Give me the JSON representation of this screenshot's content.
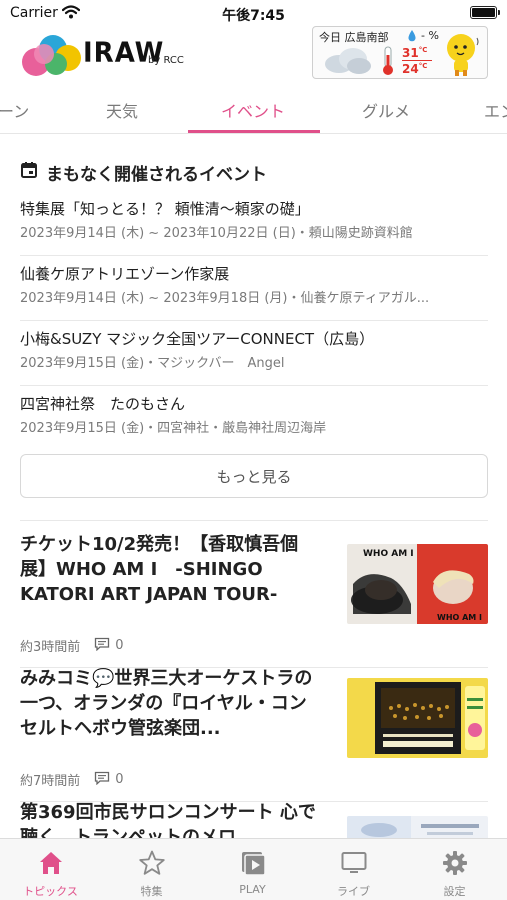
{
  "status_bar": {
    "carrier": "Carrier",
    "time": "午後7:45"
  },
  "header": {
    "logo_text": "IRAW",
    "logo_by": "by RCC",
    "weather": {
      "location": "今日 広島南部",
      "rain": "- %",
      "high": "31",
      "low": "24",
      "unit": "°C"
    }
  },
  "tabs": [
    {
      "label": "ーン",
      "active": false
    },
    {
      "label": "天気",
      "active": false
    },
    {
      "label": "イベント",
      "active": true
    },
    {
      "label": "グルメ",
      "active": false
    },
    {
      "label": "エン",
      "active": false
    }
  ],
  "events": {
    "title": "まもなく開催されるイベント",
    "items": [
      {
        "name": "特集展「知っとる！？ 頼惟清〜頼家の礎」",
        "meta": "2023年9月14日 (木) ~ 2023年10月22日 (日)・頼山陽史跡資料館"
      },
      {
        "name": "仙養ケ原アトリエゾーン作家展",
        "meta": "2023年9月14日 (木) ~ 2023年9月18日 (月)・仙養ケ原ティアガル..."
      },
      {
        "name": "小梅&SUZY マジック全国ツアーCONNECT（広島）",
        "meta": "2023年9月15日 (金)・マジックバー　Angel"
      },
      {
        "name": "四宮神社祭　たのもさん",
        "meta": "2023年9月15日 (金)・四宮神社・厳島神社周辺海岸"
      }
    ],
    "more_label": "もっと見る"
  },
  "articles": [
    {
      "title": "チケット10/2発売！【香取慎吾個展】WHO AM I　-SHINGO KATORI ART JAPAN TOUR-",
      "time": "約3時間前",
      "comments": "0",
      "thumb_text_left": "WHO AM I",
      "thumb_text_right": "WHO AM I"
    },
    {
      "title": "みみコミ💬世界三大オーケストラの一つ、オランダの『ロイヤル・コンセルトヘボウ管弦楽団...",
      "time": "約7時間前",
      "comments": "0"
    },
    {
      "title": "第369回市民サロンコンサート 心で聴く　トランペットのメロ"
    }
  ],
  "bottom_nav": [
    {
      "label": "トピックス",
      "active": true,
      "icon": "home-icon"
    },
    {
      "label": "特集",
      "active": false,
      "icon": "star-icon"
    },
    {
      "label": "PLAY",
      "active": false,
      "icon": "play-icon"
    },
    {
      "label": "ライブ",
      "active": false,
      "icon": "tv-icon"
    },
    {
      "label": "設定",
      "active": false,
      "icon": "gear-icon"
    }
  ],
  "colors": {
    "accent": "#e0508a",
    "temp": "#e0322b"
  }
}
